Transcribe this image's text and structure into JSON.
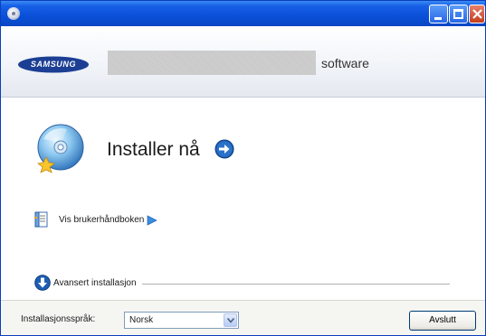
{
  "titlebar": {
    "buttons": [
      "minimize",
      "maximize",
      "close"
    ]
  },
  "header": {
    "logo_text": "SAMSUNG",
    "product_suffix": "software"
  },
  "main": {
    "install_now": "Installer nå",
    "user_guide": "Vis brukerhåndboken",
    "advanced_install": "Avansert installasjon"
  },
  "footer": {
    "language_label": "Installasjonsspråk:",
    "language_value": "Norsk",
    "exit_label": "Avslutt"
  },
  "colors": {
    "titlebar": "#0a50d8",
    "logo": "#1c3f94",
    "accent_arrow": "#1e5fb3"
  },
  "icons": [
    "system-menu-icon",
    "cd-disc-icon",
    "arrow-right-circle-icon",
    "manual-book-icon",
    "play-arrow-icon",
    "arrow-down-circle-icon",
    "chevron-down-icon"
  ]
}
